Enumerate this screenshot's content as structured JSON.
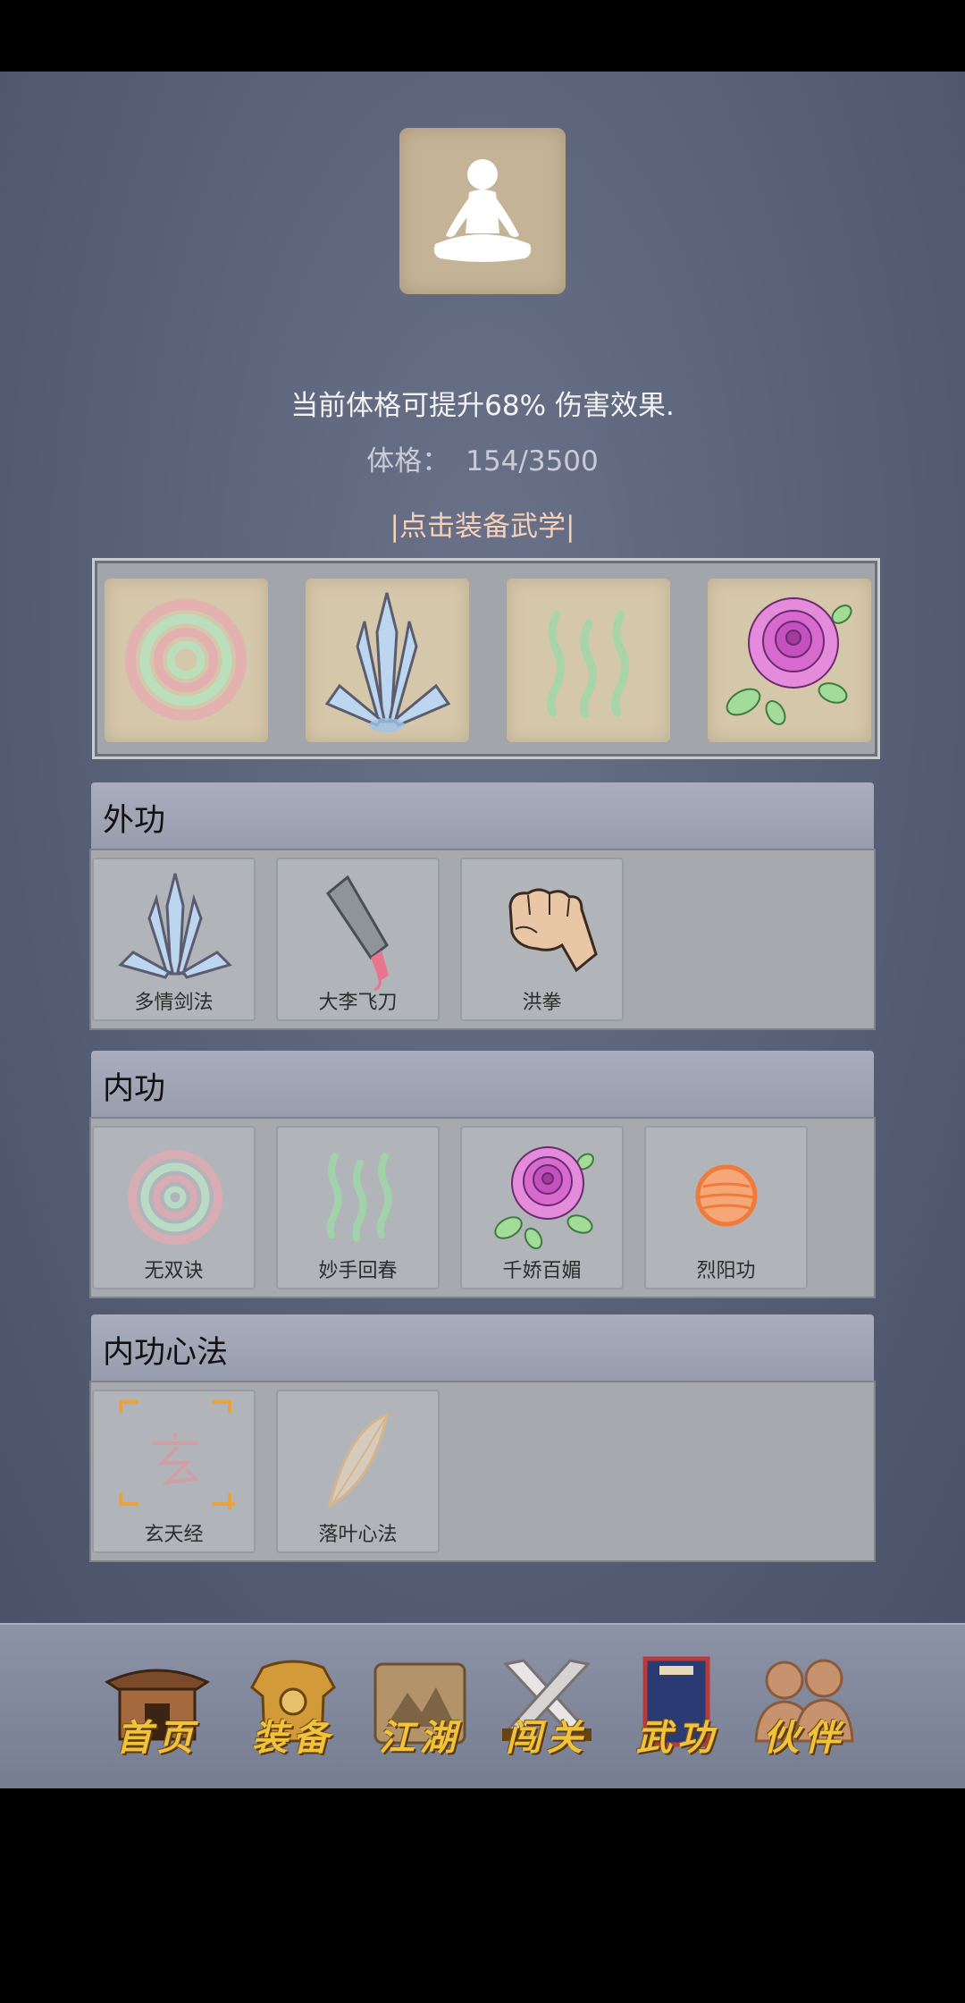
{
  "colors": {
    "background": "#586078",
    "header": "#a3a7b8",
    "card": "#b1b5ba",
    "tab_label": "#f2c23a",
    "hint": "#f6d0b8"
  },
  "avatar": {
    "icon": "meditation-silhouette-icon"
  },
  "stats": {
    "bonus_text": "当前体格可提升68% 伤害效果.",
    "physique_label": "体格：",
    "physique_value": "154/3500"
  },
  "equip_hint": "|点击装备武学|",
  "equipped": [
    {
      "icon": "spiral-icon"
    },
    {
      "icon": "blades-icon"
    },
    {
      "icon": "wavy-lines-icon"
    },
    {
      "icon": "rose-icon"
    }
  ],
  "sections": [
    {
      "title": "外功",
      "skills": [
        {
          "name": "多情剑法",
          "icon": "blades-icon"
        },
        {
          "name": "大李飞刀",
          "icon": "cleaver-icon"
        },
        {
          "name": "洪拳",
          "icon": "fist-icon"
        }
      ]
    },
    {
      "title": "内功",
      "skills": [
        {
          "name": "无双诀",
          "icon": "spiral-icon"
        },
        {
          "name": "妙手回春",
          "icon": "wavy-lines-icon"
        },
        {
          "name": "千娇百媚",
          "icon": "rose-icon"
        },
        {
          "name": "烈阳功",
          "icon": "fire-orb-icon"
        }
      ]
    },
    {
      "title": "内功心法",
      "skills": [
        {
          "name": "玄天经",
          "icon": "xuan-glyph-icon"
        },
        {
          "name": "落叶心法",
          "icon": "leaf-icon"
        }
      ]
    }
  ],
  "tabs": [
    {
      "label": "首页",
      "icon": "pavilion-icon"
    },
    {
      "label": "装备",
      "icon": "armor-icon"
    },
    {
      "label": "江湖",
      "icon": "scroll-map-icon"
    },
    {
      "label": "闯关",
      "icon": "crossed-swords-icon"
    },
    {
      "label": "武功",
      "icon": "book-icon"
    },
    {
      "label": "伙伴",
      "icon": "companions-icon"
    }
  ]
}
